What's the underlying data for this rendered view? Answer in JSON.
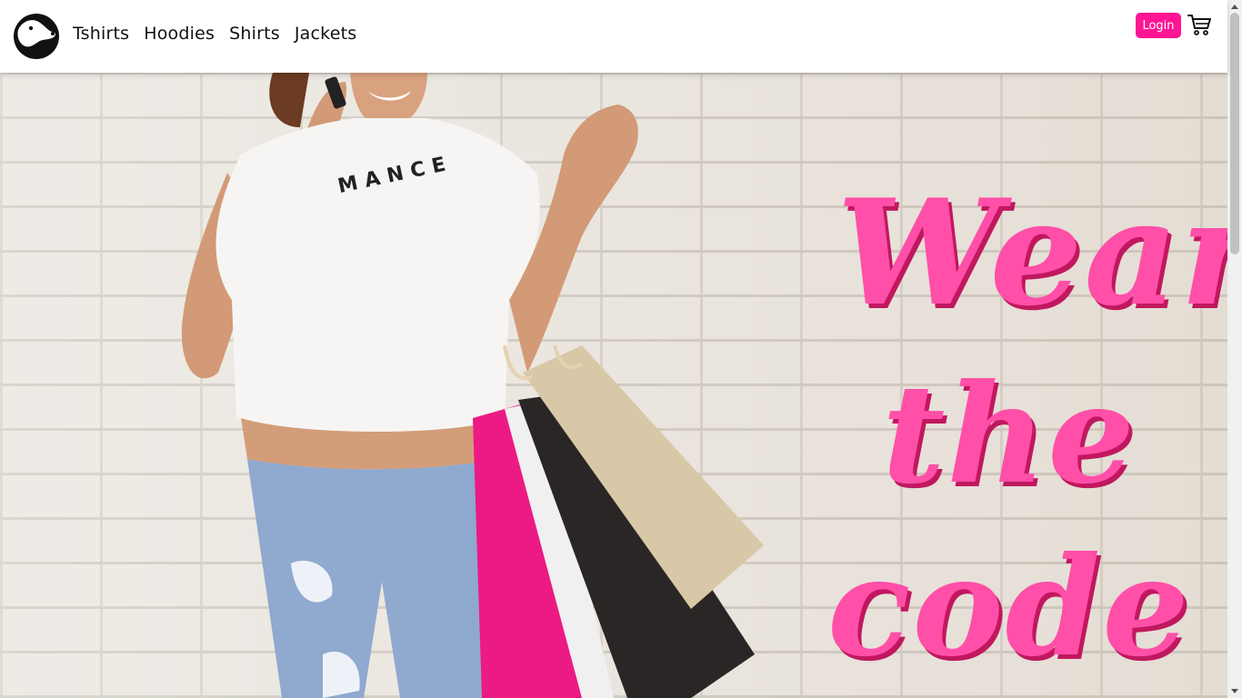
{
  "navbar": {
    "logo_icon": "dog-head-icon",
    "links": [
      "Tshirts",
      "Hoodies",
      "Shirts",
      "Jackets"
    ],
    "login_label": "Login",
    "cart_icon": "shopping-cart-icon"
  },
  "hero": {
    "shirt_text": "MANCE",
    "tagline": [
      "Wear",
      "the",
      "code"
    ]
  },
  "colors": {
    "accent": "#ff1493",
    "tagline": "#ff4fa8",
    "navbar_bg": "#ffffff"
  }
}
